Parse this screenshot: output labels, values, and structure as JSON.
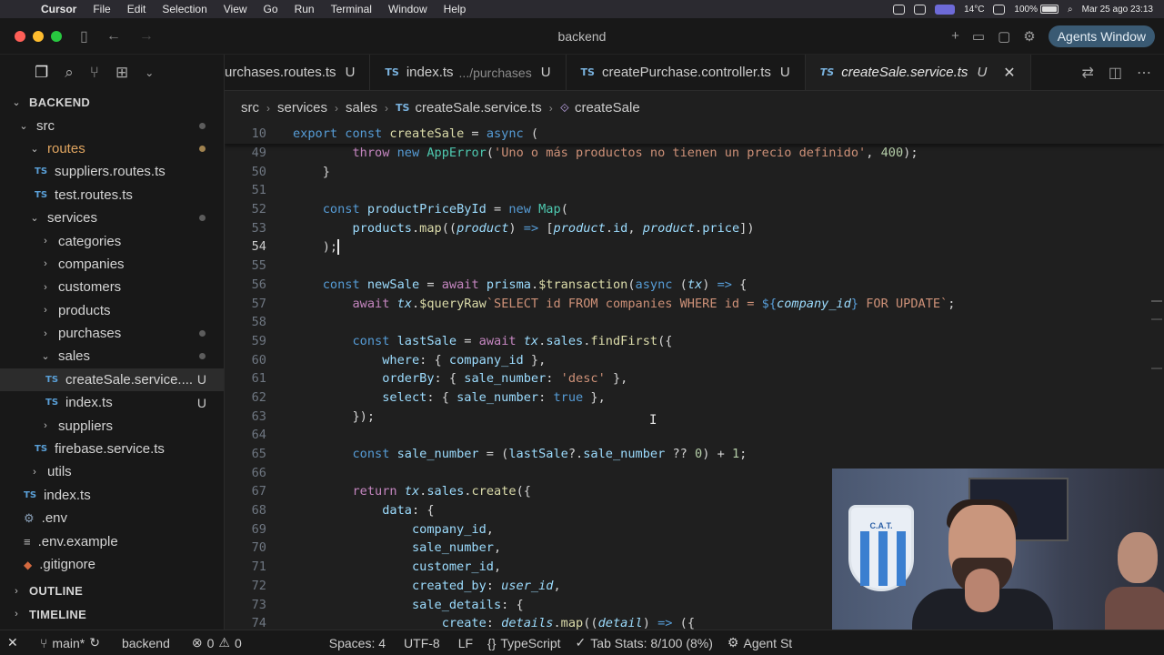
{
  "menubar": {
    "app": "Cursor",
    "items": [
      "File",
      "Edit",
      "Selection",
      "View",
      "Go",
      "Run",
      "Terminal",
      "Window",
      "Help"
    ],
    "weather": "14°C",
    "battery": "100%",
    "datetime": "Mar 25 ago  23:13"
  },
  "window": {
    "title": "backend",
    "agents_button": "Agents Window"
  },
  "sidebar": {
    "root": "BACKEND",
    "tree": [
      {
        "label": "src",
        "indent": 1,
        "chev": "⌄",
        "dot": "gray"
      },
      {
        "label": "routes",
        "indent": 2,
        "chev": "⌄",
        "dot": "orange",
        "orange": true
      },
      {
        "label": "suppliers.routes.ts",
        "indent": 3,
        "ts": true
      },
      {
        "label": "test.routes.ts",
        "indent": 3,
        "ts": true
      },
      {
        "label": "services",
        "indent": 2,
        "chev": "⌄",
        "dot": "gray"
      },
      {
        "label": "categories",
        "indent": 3,
        "chev": "›"
      },
      {
        "label": "companies",
        "indent": 3,
        "chev": "›"
      },
      {
        "label": "customers",
        "indent": 3,
        "chev": "›"
      },
      {
        "label": "products",
        "indent": 3,
        "chev": "›"
      },
      {
        "label": "purchases",
        "indent": 3,
        "chev": "›",
        "dot": "gray"
      },
      {
        "label": "sales",
        "indent": 3,
        "chev": "⌄",
        "dot": "gray"
      },
      {
        "label": "createSale.service....",
        "indent": 4,
        "ts": true,
        "badge": "U",
        "selected": true
      },
      {
        "label": "index.ts",
        "indent": 4,
        "ts": true,
        "badge": "U"
      },
      {
        "label": "suppliers",
        "indent": 3,
        "chev": "›"
      },
      {
        "label": "firebase.service.ts",
        "indent": 3,
        "ts": true
      },
      {
        "label": "utils",
        "indent": 2,
        "chev": "›"
      },
      {
        "label": "index.ts",
        "indent": 2,
        "ts": true
      },
      {
        "label": ".env",
        "indent": 1.5,
        "icon": "cog"
      },
      {
        "label": ".env.example",
        "indent": 1.5,
        "icon": "eq"
      },
      {
        "label": ".gitignore",
        "indent": 1.5,
        "icon": "git"
      }
    ],
    "outline": "OUTLINE",
    "timeline": "TIMELINE"
  },
  "tabs": [
    {
      "name": "urchases.routes.ts",
      "badge": "U"
    },
    {
      "name": "index.ts",
      "sub": ".../purchases",
      "badge": "U"
    },
    {
      "name": "createPurchase.controller.ts",
      "badge": "U"
    },
    {
      "name": "createSale.service.ts",
      "badge": "U",
      "active": true
    }
  ],
  "breadcrumb": {
    "parts": [
      "src",
      "services",
      "sales"
    ],
    "file": "createSale.service.ts",
    "symbol": "createSale"
  },
  "editor": {
    "lines": [
      {
        "n": "10",
        "sticky": true,
        "html": "<span class=\"k\">export</span> <span class=\"k\">const</span> <span class=\"f\">createSale</span> = <span class=\"k\">async</span> ("
      },
      {
        "n": "49",
        "html": "        <span class=\"kc\">throw</span> <span class=\"k\">new</span> <span class=\"t\">AppError</span>(<span class=\"s\">'Uno o más productos no tienen un precio definido'</span>, <span class=\"n\">400</span>);"
      },
      {
        "n": "50",
        "html": "    }"
      },
      {
        "n": "51",
        "html": ""
      },
      {
        "n": "52",
        "html": "    <span class=\"k\">const</span> <span class=\"v\">productPriceById</span> = <span class=\"k\">new</span> <span class=\"t\">Map</span>("
      },
      {
        "n": "53",
        "html": "        <span class=\"v\">products</span>.<span class=\"f\">map</span>((<span class=\"v i\">product</span>) <span class=\"k\">=&gt;</span> [<span class=\"v i\">product</span>.<span class=\"v\">id</span>, <span class=\"v i\">product</span>.<span class=\"v\">price</span>])"
      },
      {
        "n": "54",
        "cur": true,
        "html": "    );<span class=\"cursor\"></span>"
      },
      {
        "n": "55",
        "html": ""
      },
      {
        "n": "56",
        "html": "    <span class=\"k\">const</span> <span class=\"v\">newSale</span> = <span class=\"kc\">await</span> <span class=\"v\">prisma</span>.<span class=\"f\">$transaction</span>(<span class=\"k\">async</span> (<span class=\"v i\">tx</span>) <span class=\"k\">=&gt;</span> {"
      },
      {
        "n": "57",
        "html": "        <span class=\"kc\">await</span> <span class=\"v i\">tx</span>.<span class=\"f\">$queryRaw</span><span class=\"s\">`SELECT id FROM companies WHERE id = </span><span class=\"k\">${</span><span class=\"v i\">company_id</span><span class=\"k\">}</span><span class=\"s\"> FOR UPDATE`</span>;"
      },
      {
        "n": "58",
        "html": ""
      },
      {
        "n": "59",
        "html": "        <span class=\"k\">const</span> <span class=\"v\">lastSale</span> = <span class=\"kc\">await</span> <span class=\"v i\">tx</span>.<span class=\"v\">sales</span>.<span class=\"f\">findFirst</span>({"
      },
      {
        "n": "60",
        "html": "            <span class=\"v\">where</span>: { <span class=\"v\">company_id</span> },"
      },
      {
        "n": "61",
        "html": "            <span class=\"v\">orderBy</span>: { <span class=\"v\">sale_number</span>: <span class=\"s\">'desc'</span> },"
      },
      {
        "n": "62",
        "html": "            <span class=\"v\">select</span>: { <span class=\"v\">sale_number</span>: <span class=\"k\">true</span> },"
      },
      {
        "n": "63",
        "html": "        });"
      },
      {
        "n": "64",
        "html": ""
      },
      {
        "n": "65",
        "html": "        <span class=\"k\">const</span> <span class=\"v\">sale_number</span> = (<span class=\"v\">lastSale</span>?.<span class=\"v\">sale_number</span> ?? <span class=\"n\">0</span>) + <span class=\"n\">1</span>;"
      },
      {
        "n": "66",
        "html": ""
      },
      {
        "n": "67",
        "html": "        <span class=\"kc\">return</span> <span class=\"v i\">tx</span>.<span class=\"v\">sales</span>.<span class=\"f\">create</span>({"
      },
      {
        "n": "68",
        "html": "            <span class=\"v\">data</span>: {"
      },
      {
        "n": "69",
        "html": "                <span class=\"v\">company_id</span>,"
      },
      {
        "n": "70",
        "html": "                <span class=\"v\">sale_number</span>,"
      },
      {
        "n": "71",
        "html": "                <span class=\"v\">customer_id</span>,"
      },
      {
        "n": "72",
        "html": "                <span class=\"v\">created_by</span>: <span class=\"v i\">user_id</span>,"
      },
      {
        "n": "73",
        "html": "                <span class=\"v\">sale_details</span>: {"
      },
      {
        "n": "74",
        "html": "                    <span class=\"v\">create</span>: <span class=\"v i\">details</span>.<span class=\"f\">map</span>((<span class=\"v i\">detail</span>) <span class=\"k\">=&gt;</span> ({"
      }
    ]
  },
  "webcam": {
    "shield_text": "C.A.T."
  },
  "statusbar": {
    "branch": "main*",
    "folder": "backend",
    "errors": "0",
    "warnings": "0",
    "spaces": "Spaces: 4",
    "encoding": "UTF-8",
    "eol": "LF",
    "language": "TypeScript",
    "tabstats": "Tab Stats: 8/100 (8%)",
    "agent": "Agent St"
  },
  "colors": {
    "accent": "#3a5a73",
    "modified": "#e0a560",
    "ts_icon": "#5aa0d8"
  }
}
